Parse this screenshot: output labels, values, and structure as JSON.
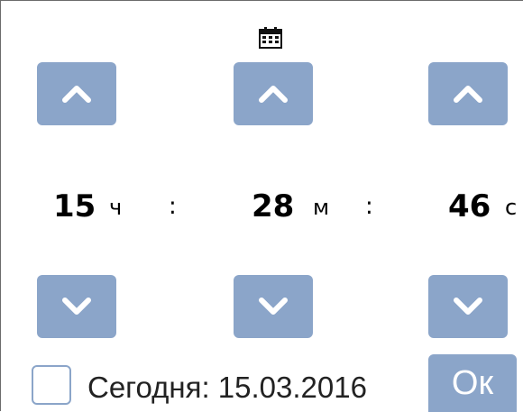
{
  "header": {
    "icon": "calendar-icon"
  },
  "time": {
    "hours": {
      "value": "15",
      "unit": "ч"
    },
    "minutes": {
      "value": "28",
      "unit": "м"
    },
    "seconds": {
      "value": "46",
      "unit": "с"
    },
    "separator": ":"
  },
  "controls": {
    "increment_icon": "chevron-up-icon",
    "decrement_icon": "chevron-down-icon"
  },
  "footer": {
    "today_label": "Сегодня: 15.03.2016",
    "today_checked": false,
    "ok_label": "Ок"
  },
  "colors": {
    "button_bg": "#8ba5c9",
    "button_fg": "#ffffff",
    "text": "#000000",
    "border": "#6b6b6b"
  }
}
